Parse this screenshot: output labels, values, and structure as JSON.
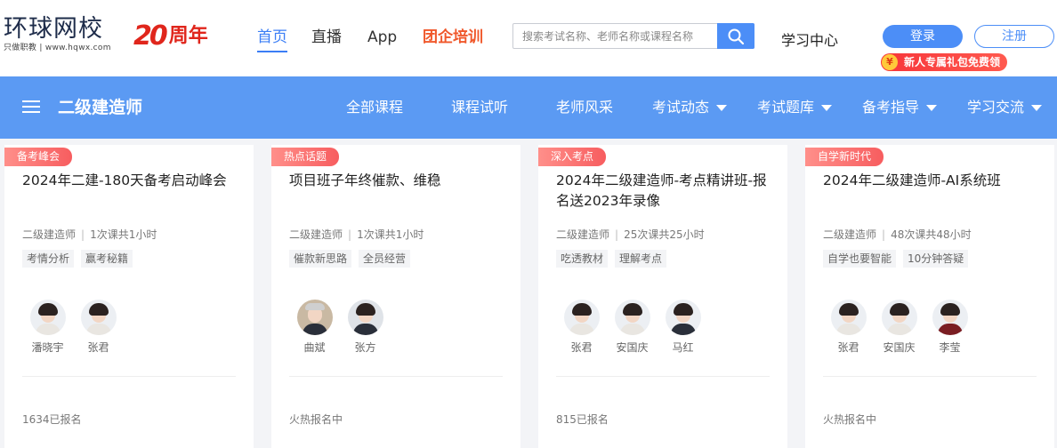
{
  "header": {
    "logo": {
      "main": "环球网校",
      "sub": "只做职教 | www.hqwx.com"
    },
    "anniversary": {
      "number": "20",
      "text": "周年"
    },
    "nav": [
      {
        "label": "首页",
        "active": true
      },
      {
        "label": "直播"
      },
      {
        "label": "App"
      },
      {
        "label": "团企培训",
        "highlight": "#f0582b"
      }
    ],
    "search": {
      "placeholder": "搜索考试名称、老师名称或课程名称",
      "value": ""
    },
    "study_center": "学习中心",
    "login": "登录",
    "register": "注册",
    "gift": {
      "icon": "¥",
      "label": "新人专属礼包免费领"
    }
  },
  "subnav": {
    "subject": "二级建造师",
    "items": [
      {
        "label": "全部课程",
        "dropdown": false
      },
      {
        "label": "课程试听",
        "dropdown": false
      },
      {
        "label": "老师风采",
        "dropdown": false
      },
      {
        "label": "考试动态",
        "dropdown": true
      },
      {
        "label": "考试题库",
        "dropdown": true
      },
      {
        "label": "备考指导",
        "dropdown": true
      },
      {
        "label": "学习交流",
        "dropdown": true
      }
    ]
  },
  "cards": [
    {
      "tag": "备考峰会",
      "title": "2024年二建-180天备考启动峰会",
      "category": "二级建造师",
      "lessons": "1次课共1小时",
      "chips": [
        "考情分析",
        "赢考秘籍"
      ],
      "teachers": [
        "潘晓宇",
        "张君"
      ],
      "enrollment": "1634已报名"
    },
    {
      "tag": "热点话题",
      "title": "项目班子年终催款、维稳",
      "category": "二级建造师",
      "lessons": "1次课共1小时",
      "chips": [
        "催款新思路",
        "全员经营"
      ],
      "teachers": [
        "曲斌",
        "张方"
      ],
      "enrollment": "火热报名中"
    },
    {
      "tag": "深入考点",
      "title": "2024年二级建造师-考点精讲班-报名送2023年录像",
      "category": "二级建造师",
      "lessons": "25次课共25小时",
      "chips": [
        "吃透教材",
        "理解考点"
      ],
      "teachers": [
        "张君",
        "安国庆",
        "马红"
      ],
      "enrollment": "815已报名"
    },
    {
      "tag": "自学新时代",
      "title": "2024年二级建造师-AI系统班",
      "category": "二级建造师",
      "lessons": "48次课共48小时",
      "chips": [
        "自学也要智能",
        "10分钟答疑"
      ],
      "teachers": [
        "张君",
        "安国庆",
        "李莹"
      ],
      "enrollment": "火热报名中"
    }
  ],
  "colors": {
    "brand_blue": "#5b9af3",
    "accent_red": "#e0261c",
    "tag_red": "#f75d5f"
  }
}
